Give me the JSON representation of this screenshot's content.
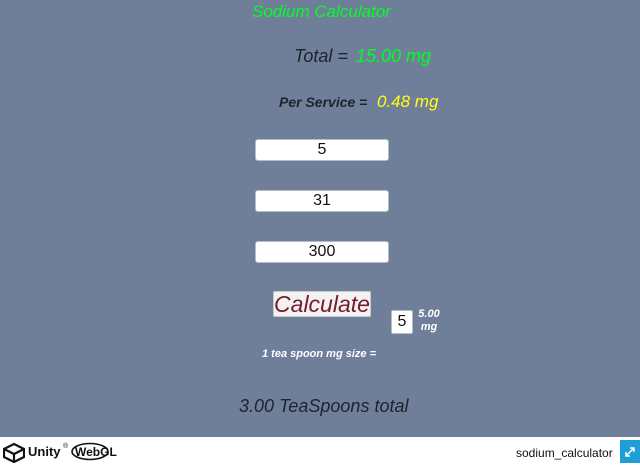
{
  "app": {
    "title": "Sodium Calculator",
    "total_label": "Total =",
    "total_value": "15.00 mg",
    "per_service_label": "Per Service =",
    "per_service_value": "0.48 mg"
  },
  "inputs": {
    "field1": "5",
    "field2": "31",
    "field3": "300",
    "teaspoon_mg": "5"
  },
  "actions": {
    "calculate_label": "Calculate"
  },
  "teaspoon": {
    "label": "1 tea spoon mg size =",
    "value_line1": "5.00",
    "value_line2": "mg"
  },
  "result": {
    "text": "3.00 TeaSpoons total"
  },
  "footer": {
    "unity_text": "Unity",
    "unity_tm": "®",
    "webgl_text": "WebGL",
    "build_name": "sodium_calculator"
  },
  "colors": {
    "canvas_bg": "#6f7f99",
    "green": "#00ff22",
    "yellow": "#ffff11",
    "calculate_text": "#7a1a2a",
    "fullscreen_btn": "#1e9ed6"
  },
  "icons": {
    "unity_logo": "unity-logo-icon",
    "fullscreen": "fullscreen-icon"
  }
}
